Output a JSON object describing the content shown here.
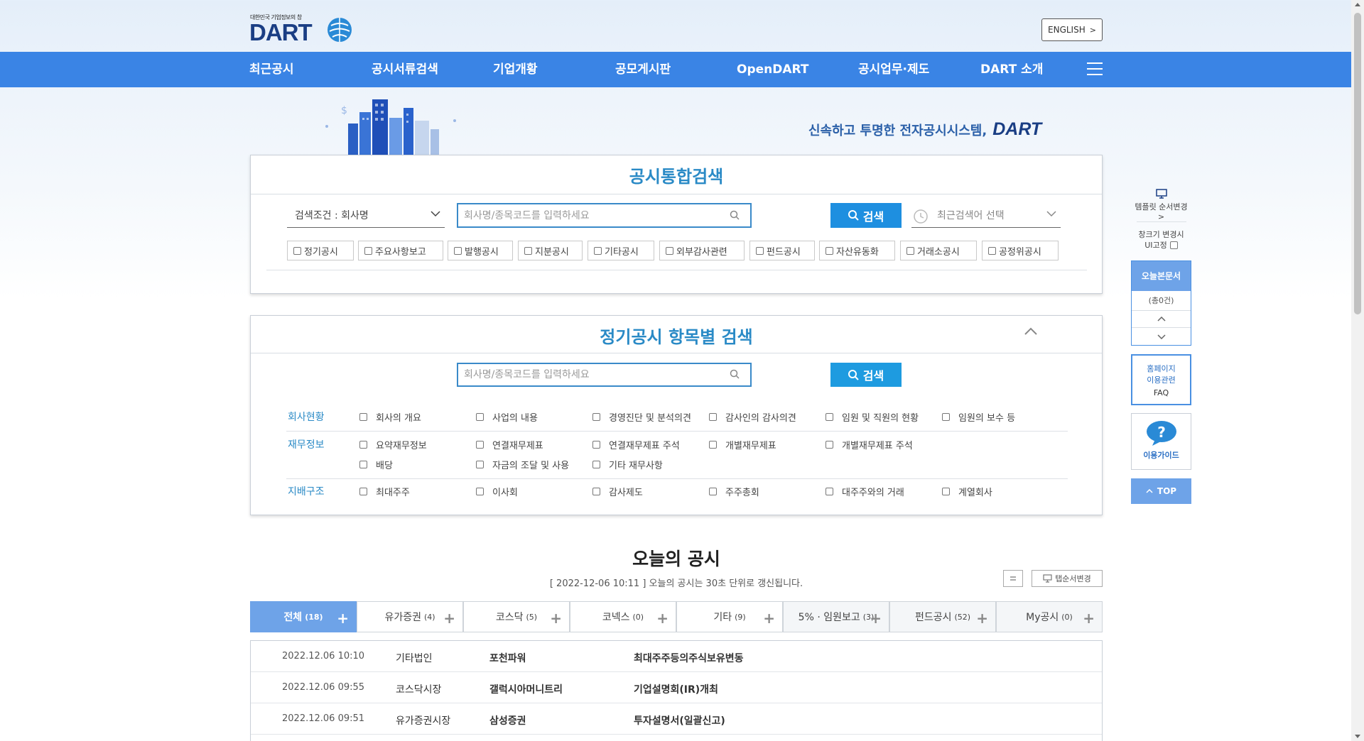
{
  "header": {
    "logo_small": "대한민국 기업정보의 창",
    "logo_big": "DART",
    "english_label": "ENGLISH"
  },
  "nav": {
    "items": [
      "최근공시",
      "공시서류검색",
      "기업개황",
      "공모게시판",
      "OpenDART",
      "공시업무·제도",
      "DART 소개"
    ]
  },
  "hero": {
    "slogan": "신속하고 투명한 전자공시시스템,",
    "slogan_brand": "DART"
  },
  "unified_search": {
    "title": "공시통합검색",
    "condition": "검색조건 : 회사명",
    "placeholder": "회사명/종목코드를 입력하세요",
    "button": "검색",
    "recent": "최근검색어 선택",
    "filters": [
      "정기공시",
      "주요사항보고",
      "발행공시",
      "지분공시",
      "기타공시",
      "외부감사관련",
      "펀드공시",
      "자산유동화",
      "거래소공시",
      "공정위공시"
    ]
  },
  "periodic_search": {
    "title": "정기공시 항목별 검색",
    "placeholder": "회사명/종목코드를 입력하세요",
    "button": "검색",
    "categories": [
      {
        "label": "회사현황",
        "options": [
          "회사의 개요",
          "사업의 내용",
          "경영진단 및 분석의견",
          "감사인의 감사의견",
          "임원 및 직원의 현황",
          "임원의 보수 등"
        ]
      },
      {
        "label": "재무정보",
        "options": [
          "요약재무정보",
          "연결재무제표",
          "연결재무제표 주석",
          "개별재무제표",
          "개별재무제표 주석"
        ],
        "options2": [
          "배당",
          "자금의 조달 및 사용",
          "기타 재무사항"
        ]
      },
      {
        "label": "지배구조",
        "options": [
          "최대주주",
          "이사회",
          "감사제도",
          "주주총회",
          "대주주와의 거래",
          "계열회사"
        ]
      }
    ]
  },
  "sidebar": {
    "template_label": "템플릿 순서변경",
    "window_label_1": "창크기 변경시",
    "window_label_2": "UI고정",
    "today_docs": "오늘본문서",
    "today_count": "(총0건)",
    "homepage_1": "홈페이지",
    "homepage_2": "이용관련",
    "faq": "FAQ",
    "guide": "이용가이드",
    "top": "TOP"
  },
  "today": {
    "title": "오늘의 공시",
    "subtitle": "[ 2022-12-06 10:11 ] 오늘의 공시는 30초 단위로 갱신됩니다.",
    "tab_order_label": "탭순서변경",
    "tabs": [
      {
        "label": "전체",
        "count": "(18)"
      },
      {
        "label": "유가증권",
        "count": "(4)"
      },
      {
        "label": "코스닥",
        "count": "(5)"
      },
      {
        "label": "코넥스",
        "count": "(0)"
      },
      {
        "label": "기타",
        "count": "(9)"
      },
      {
        "label": "5% · 임원보고",
        "count": "(3)"
      },
      {
        "label": "펀드공시",
        "count": "(52)"
      },
      {
        "label": "My공시",
        "count": "(0)"
      }
    ],
    "rows": [
      {
        "time": "2022.12.06 10:10",
        "market": "기타법인",
        "company": "포천파워",
        "report": "최대주주등의주식보유변동"
      },
      {
        "time": "2022.12.06 09:55",
        "market": "코스닥시장",
        "company": "갤럭시아머니트리",
        "report": "기업설명회(IR)개최"
      },
      {
        "time": "2022.12.06 09:51",
        "market": "유가증권시장",
        "company": "삼성증권",
        "report": "투자설명서(일괄신고)"
      }
    ]
  },
  "colors": {
    "nav": "#3a84e5",
    "accent": "#2a8ac6",
    "button": "#1e8fe0",
    "brand": "#1a3e84"
  }
}
